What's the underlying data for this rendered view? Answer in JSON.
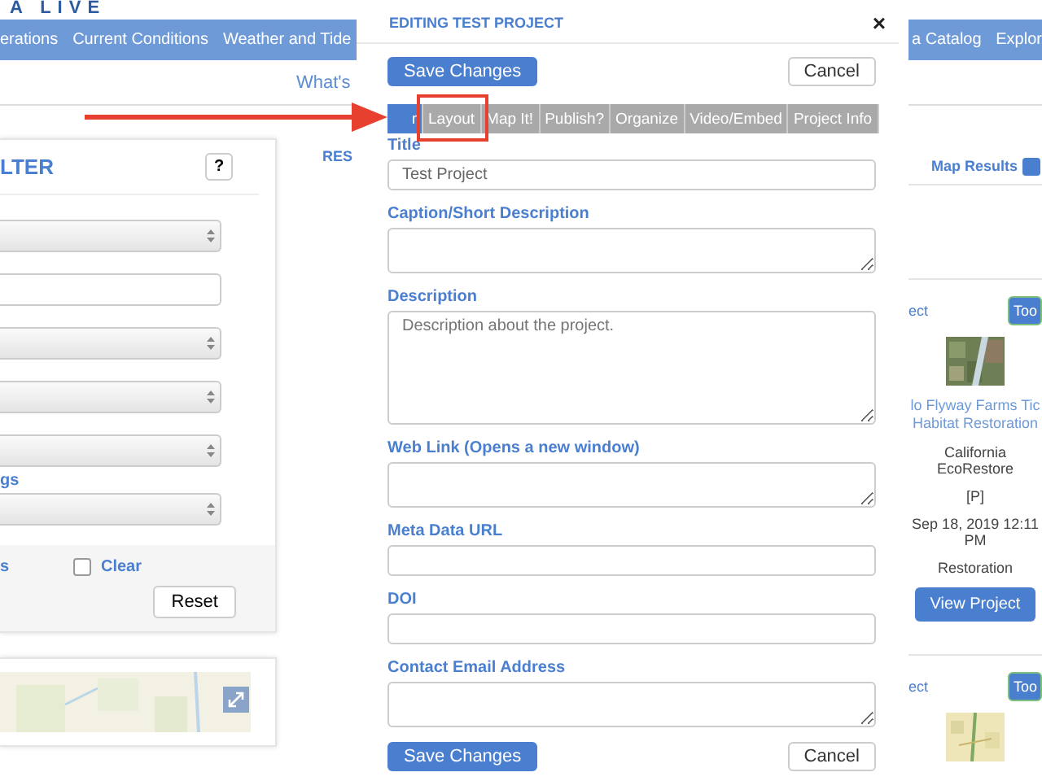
{
  "logo": {
    "text": "A LIVE"
  },
  "nav": {
    "left": [
      "erations",
      "Current Conditions",
      "Weather and Tide"
    ],
    "right": [
      "a Catalog",
      "Explor"
    ]
  },
  "subnav": {
    "link": "What's"
  },
  "filter": {
    "title": "LTER",
    "help": "?",
    "controls": [
      {
        "kind": "select"
      },
      {
        "kind": "input"
      },
      {
        "kind": "select"
      },
      {
        "kind": "select"
      },
      {
        "kind": "select"
      },
      {
        "kind": "label",
        "text": "gs"
      },
      {
        "kind": "select"
      }
    ],
    "footer_link": "s",
    "clear": {
      "label": "Clear",
      "checked": false
    },
    "reset": "Reset"
  },
  "results": {
    "heading": "RES",
    "map_results": {
      "label": "Map Results",
      "checked": true
    },
    "cards": [
      {
        "link": "ect",
        "tool": "Too",
        "title": "lo Flyway Farms Tic Habitat Restoration",
        "org": "California EcoRestore",
        "flag": "[P]",
        "date": "Sep 18, 2019 12:11 PM",
        "category": "Restoration",
        "button": "View Project"
      },
      {
        "link": "ect",
        "tool": "Too"
      }
    ]
  },
  "modal": {
    "title": "EDITING TEST PROJECT",
    "close": "×",
    "save": "Save Changes",
    "cancel": "Cancel",
    "tabs": [
      {
        "label": "r",
        "selected": true
      },
      {
        "label": "Layout",
        "selected": false,
        "highlighted": true
      },
      {
        "label": "Map It!",
        "selected": false
      },
      {
        "label": "Publish?",
        "selected": false
      },
      {
        "label": "Organize",
        "selected": false
      },
      {
        "label": "Video/Embed",
        "selected": false
      },
      {
        "label": "Project Info",
        "selected": false
      }
    ],
    "fields": [
      {
        "label": "Title",
        "kind": "input",
        "value": "Test Project"
      },
      {
        "label": "Caption/Short Description",
        "kind": "textarea"
      },
      {
        "label": "Description",
        "kind": "largetextarea",
        "placeholder": "Description about the project."
      },
      {
        "label": "Web Link (Opens a new window)",
        "kind": "textarea"
      },
      {
        "label": "Meta Data URL",
        "kind": "input"
      },
      {
        "label": "DOI",
        "kind": "input"
      },
      {
        "label": "Contact Email Address",
        "kind": "textarea"
      }
    ],
    "footer_save": "Save Changes",
    "footer_cancel": "Cancel"
  }
}
